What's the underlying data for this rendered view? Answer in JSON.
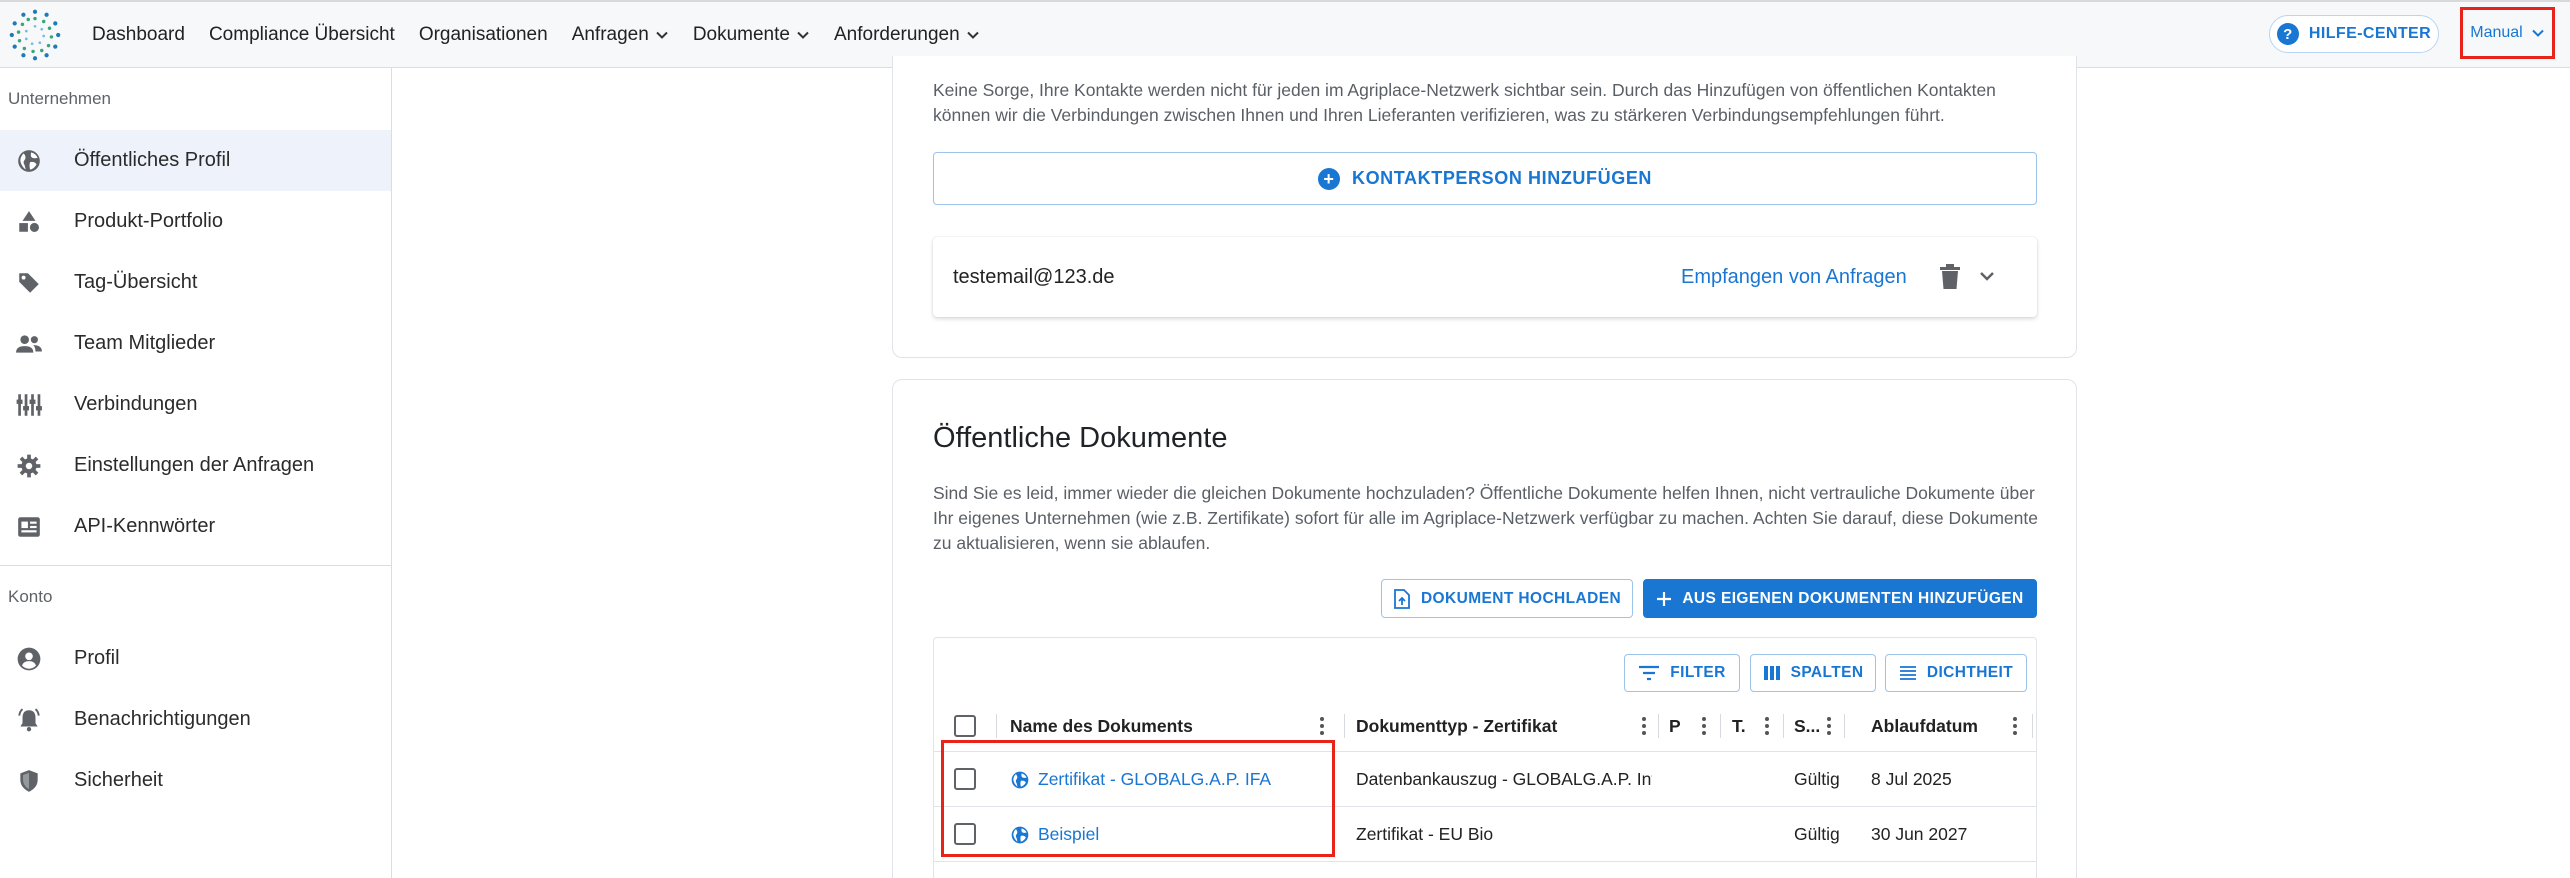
{
  "nav": {
    "items": [
      {
        "label": "Dashboard",
        "dropdown": false
      },
      {
        "label": "Compliance Übersicht",
        "dropdown": false
      },
      {
        "label": "Organisationen",
        "dropdown": false
      },
      {
        "label": "Anfragen",
        "dropdown": true
      },
      {
        "label": "Dokumente",
        "dropdown": true
      },
      {
        "label": "Anforderungen",
        "dropdown": true
      }
    ],
    "help_label": "HILFE-CENTER",
    "manual_label": "Manual"
  },
  "sidebar": {
    "section_company": "Unternehmen",
    "company_items": [
      {
        "label": "Öffentliches Profil",
        "icon": "globe-icon",
        "active": true
      },
      {
        "label": "Produkt-Portfolio",
        "icon": "shapes-icon",
        "active": false
      },
      {
        "label": "Tag-Übersicht",
        "icon": "tag-icon",
        "active": false
      },
      {
        "label": "Team Mitglieder",
        "icon": "people-icon",
        "active": false
      },
      {
        "label": "Verbindungen",
        "icon": "connections-icon",
        "active": false
      },
      {
        "label": "Einstellungen der Anfragen",
        "icon": "gear-icon",
        "active": false
      },
      {
        "label": "API-Kennwörter",
        "icon": "api-key-icon",
        "active": false
      }
    ],
    "section_account": "Konto",
    "account_items": [
      {
        "label": "Profil",
        "icon": "account-circle-icon"
      },
      {
        "label": "Benachrichtigungen",
        "icon": "bell-icon"
      },
      {
        "label": "Sicherheit",
        "icon": "shield-icon"
      }
    ]
  },
  "contacts": {
    "description": "Keine Sorge, Ihre Kontakte werden nicht für jeden im Agriplace-Netzwerk sichtbar sein. Durch das Hinzufügen von öffentlichen Kontakten können wir die Verbindungen zwischen Ihnen und Ihren Lieferanten verifizieren, was zu stärkeren Verbindungsempfehlungen führt.",
    "add_button": "KONTAKTPERSON HINZUFÜGEN",
    "entries": [
      {
        "email": "testemail@123.de",
        "role": "Empfangen von Anfragen"
      }
    ]
  },
  "documents": {
    "title": "Öffentliche Dokumente",
    "description": "Sind Sie es leid, immer wieder die gleichen Dokumente hochzuladen? Öffentliche Dokumente helfen Ihnen, nicht vertrauliche Dokumente über Ihr eigenes Unternehmen (wie z.B. Zertifikate) sofort für alle im Agriplace-Netzwerk verfügbar zu machen. Achten Sie darauf, diese Dokumente zu aktualisieren, wenn sie ablaufen.",
    "upload_button": "DOKUMENT HOCHLADEN",
    "add_own_button": "AUS EIGENEN DOKUMENTEN HINZUFÜGEN",
    "toolbar": {
      "filter": "FILTER",
      "columns": "SPALTEN",
      "density": "DICHTHEIT"
    },
    "columns": [
      "Name des Dokuments",
      "Dokumenttyp - Zertifikat",
      "P",
      "T.",
      "S...",
      "Ablaufdatum"
    ],
    "rows": [
      {
        "name": "Zertifikat - GLOBALG.A.P. IFA",
        "type": "Datenbankauszug - GLOBALG.A.P. Inte",
        "status": "Gültig",
        "expiry": "8 Jul 2025"
      },
      {
        "name": "Beispiel",
        "type": "Zertifikat - EU Bio",
        "status": "Gültig",
        "expiry": "30 Jun 2027"
      }
    ]
  },
  "colors": {
    "accent": "#1976d2",
    "highlight": "#e8231a",
    "active_bg": "#eef3fb"
  }
}
